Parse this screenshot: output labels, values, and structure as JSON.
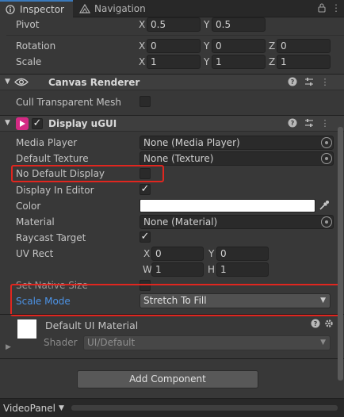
{
  "tabs": {
    "inspector": "Inspector",
    "navigation": "Navigation"
  },
  "window_icons": {
    "lock": "lock-icon",
    "menu": "kebab-menu-icon"
  },
  "rect_transform": {
    "pivot_label": "Pivot",
    "pivot_x": "0.5",
    "pivot_y": "0.5",
    "rotation_label": "Rotation",
    "rotation_x": "0",
    "rotation_y": "0",
    "rotation_z": "0",
    "scale_label": "Scale",
    "scale_x": "1",
    "scale_y": "1",
    "scale_z": "1",
    "axis_x": "X",
    "axis_y": "Y",
    "axis_z": "Z"
  },
  "canvas_renderer": {
    "title": "Canvas Renderer",
    "cull_label": "Cull Transparent Mesh",
    "cull_checked": false
  },
  "display_ugui": {
    "title": "Display uGUI",
    "enabled": true,
    "media_player_label": "Media Player",
    "media_player_value": "None (Media Player)",
    "default_texture_label": "Default Texture",
    "default_texture_value": "None (Texture)",
    "no_default_display_label": "No Default Display",
    "no_default_display_checked": false,
    "display_in_editor_label": "Display In Editor",
    "display_in_editor_checked": true,
    "color_label": "Color",
    "color_value": "#ffffff",
    "material_label": "Material",
    "material_value": "None (Material)",
    "raycast_label": "Raycast Target",
    "raycast_checked": true,
    "uvrect_label": "UV Rect",
    "uv_axis_x": "X",
    "uv_axis_y": "Y",
    "uv_axis_w": "W",
    "uv_axis_h": "H",
    "uv_x": "0",
    "uv_y": "0",
    "uv_w": "1",
    "uv_h": "1",
    "set_native_size_label": "Set Native Size",
    "scale_mode_label": "Scale Mode",
    "scale_mode_value": "Stretch To Fill"
  },
  "material_preview": {
    "name": "Default UI Material",
    "shader_label": "Shader",
    "shader_value": "UI/Default"
  },
  "add_component_label": "Add Component",
  "status": {
    "panel_label": "VideoPanel"
  },
  "colors": {
    "accent": "#3a79bb",
    "highlight_box": "#e0261f",
    "link_label": "#4c93e6"
  }
}
